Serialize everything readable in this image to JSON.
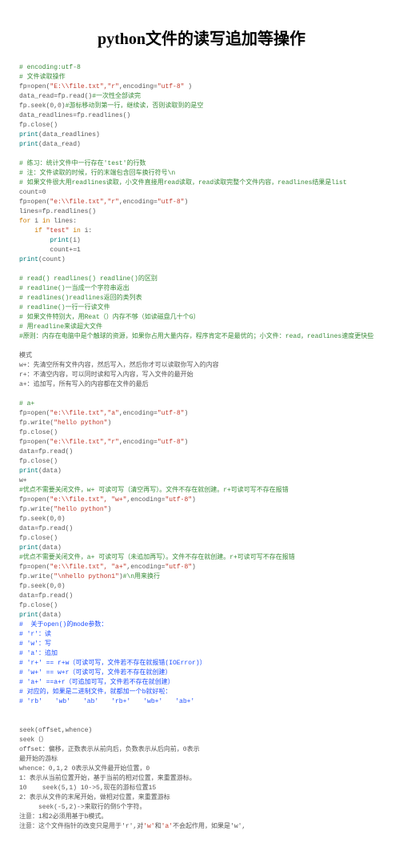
{
  "title": "python文件的读写追加等操作",
  "block1": {
    "l1": "# encoding:utf-8",
    "l2": "# 文件读取操作",
    "l3a": "fp=open(",
    "l3b": "\"E:\\\\file.txt\",\"r\"",
    "l3c": ",encoding=",
    "l3d": "\"utf-8\"",
    "l3e": " )",
    "l4a": "data_read=fp.read()",
    "l4b": "#一次性全部读完",
    "l5a": "fp.seek(0,0)",
    "l5b": "#游标移动到第一行，继续读，否则读取到的是空",
    "l6": "data_readlines=fp.readlines()",
    "l7": "fp.close()",
    "l8a": "print",
    "l8b": "(data_readlines)",
    "l9a": "print",
    "l9b": "(data_read)"
  },
  "block2": {
    "c1": "# 练习：统计文件中一行存在'test'的行数",
    "c2": "# 注：文件读取的时候，行的末端包含回车换行符号\\n",
    "c3": "# 如果文件很大用readlines读取，小文件直接用read读取，read读取完整个文件内容，readlines结果是list",
    "l1": "count=0",
    "l2a": "fp=open(",
    "l2b": "\"e:\\\\file.txt\",\"r\"",
    "l2c": ",encoding=",
    "l2d": "\"utf-8\"",
    "l2e": ")",
    "l3": "lines=fp.readlines()",
    "l4a": "for",
    "l4b": " i ",
    "l4c": "in",
    "l4d": " lines:",
    "l5a": "    if ",
    "l5b": "\"test\"",
    "l5c": " in",
    "l5d": " i:",
    "l6a": "        print",
    "l6b": "(i)",
    "l7": "        count+=1",
    "l8a": "print",
    "l8b": "(count)"
  },
  "block3": {
    "c1": "# read() readlines() readline()的区别",
    "c2": "# readline()一当成一个字符串返出",
    "c3": "# readlines()readlines返回的类列表",
    "c4": "# readline()一行一行读文件",
    "c5": "# 如果文件特别大，用Reat（）内存不够（如读磁盘几十个G）",
    "c6": "# 用readline来读超大文件",
    "c7": "#原则：内存在电脑中是个触球的资源，如果你占用大量内存，程序肯定不是最优的；小文件：read，readlines速度更快些"
  },
  "mode1": {
    "l1": "模式",
    "l2": "w+：先清空所有文件内容，然后写入，然后你才可以读取你写入的内容",
    "l3": "r+：不清空内容，可以同时读和写入内容，写入文件的最开始",
    "l4": "a+：追加写，所有写入的内容都在文件的最后"
  },
  "block4": {
    "c1": "# a+",
    "l1a": "fp=open(",
    "l1b": "\"e:\\\\file.txt\",\"a\"",
    "l1c": ",encoding=",
    "l1d": "\"utf-8\"",
    "l1e": ")",
    "l2a": "fp.write(",
    "l2b": "\"hello python\"",
    "l2c": ")",
    "l3": "fp.close()",
    "l4a": "fp=open(",
    "l4b": "\"e:\\\\file.txt\",\"r\"",
    "l4c": ",encoding=",
    "l4d": "\"utf-8\"",
    "l4e": ")",
    "l5": "data=fp.read()",
    "l6": "fp.close()",
    "l7a": "print",
    "l7b": "(data)"
  },
  "block5": {
    "l1": "w+",
    "c1": "#优点不需要关闭文件，w+ 可读可写（清空再写）。文件不存在就创建。r+可读可写不存在报错",
    "l2a": "fp=open(",
    "l2b": "\"e:\\\\file.txt\", \"w+\"",
    "l2c": ",encoding=",
    "l2d": "\"utf-8\"",
    "l2e": ")",
    "l3a": "fp.write(",
    "l3b": "\"hello python\"",
    "l3c": ")",
    "l4": "fp.seek(0,0)",
    "l5": "data=fp.read()",
    "l6": "fp.close()",
    "l7a": "print",
    "l7b": "(data)"
  },
  "block6": {
    "c1": "#优点不需要关闭文件，a+ 可读可写（未追加再写）。文件不存在就创建。r+可读可写不存在报错",
    "l1a": "fp=open(",
    "l1b": "\"e:\\\\file.txt\", \"a+\"",
    "l1c": ",encoding=",
    "l1d": "\"utf-8\"",
    "l1e": ")",
    "l2a": "fp.write(",
    "l2b": "\"\\nhello python1\"",
    "l2c": ")",
    "l2d": "#\\n用来换行",
    "l3": "fp.seek(0,0)",
    "l4": "data=fp.read()",
    "l5": "fp.close()",
    "l6a": "print",
    "l6b": "(data)"
  },
  "block7": {
    "c1": "#  关于open()的mode参数：",
    "c2": "# 'r'：读",
    "c3": "# 'w'：写",
    "c4": "# 'a'：追加",
    "c5": "# 'r+' == r+w（可读可写，文件若不存在就报错(IOError)）",
    "c6": "# 'w+' == w+r（可读可写，文件若不存在就创建）",
    "c7": "# 'a+' ==a+r（可追加可写，文件若不存在就创建）",
    "c8": "# 对应的，如果是二进制文件，就都加一个b就好啦：",
    "c9": "# 'rb'　　'wb'　　'ab'　　'rb+'　　'wb+'　　'ab+'"
  },
  "seekblock": {
    "l1": "seek(offset,whence)",
    "l2": "seek（）",
    "l3": "offset：偏移，正数表示从前向后，负数表示从后向前，0表示",
    "l4": "最开始的游标",
    "l5": "whence：0,1,2 0表示从文件最开始位置，0",
    "l6": "1：表示从当前位置开始，基于当前的相对位置，来重置游标。",
    "l7": "10    seek(5,1) 10->5,现在的游标位置15",
    "l8": "2：表示从文件的末尾开始，做相对位置，来重置游标",
    "l9": "     seek(-5,2)->来取行的倒5个字符。",
    "l10": "注意：1和2必须用基于b模式。",
    "l11a": "注意：这个文件指针的改变只是用于'r',对",
    "l11b": "'w'",
    "l11c": "和",
    "l11d": "'a'",
    "l11e": "不会起作用，如果是'w',"
  }
}
